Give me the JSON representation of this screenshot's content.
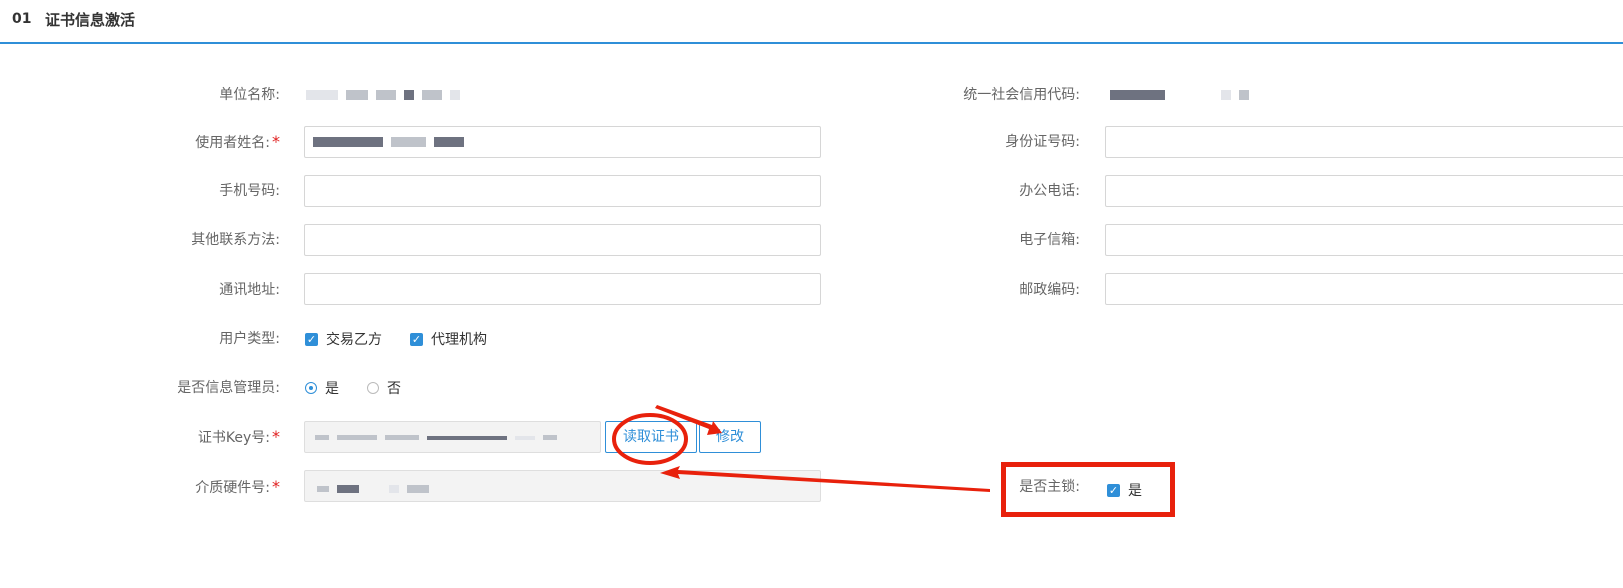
{
  "header": {
    "number": "01",
    "title": "证书信息激活"
  },
  "form": {
    "unit_name_label": "单位名称:",
    "credit_code_label": "统一社会信用代码:",
    "user_name_label": "使用者姓名:",
    "id_number_label": "身份证号码:",
    "mobile_label": "手机号码:",
    "office_phone_label": "办公电话:",
    "other_contact_label": "其他联系方法:",
    "email_label": "电子信箱:",
    "address_label": "通讯地址:",
    "postcode_label": "邮政编码:",
    "user_type_label": "用户类型:",
    "user_type_options": [
      "交易乙方",
      "代理机构"
    ],
    "is_admin_label": "是否信息管理员:",
    "is_admin_options": [
      "是",
      "否"
    ],
    "cert_key_label": "证书Key号:",
    "media_hw_label": "介质硬件号:",
    "is_master_lock_label": "是否主锁:",
    "is_master_lock_value": "是",
    "required_mark": "*"
  },
  "buttons": {
    "read_cert": "读取证书",
    "modify": "修改"
  },
  "colors": {
    "accent": "#2f8fd8",
    "annotation": "#e8210c"
  }
}
